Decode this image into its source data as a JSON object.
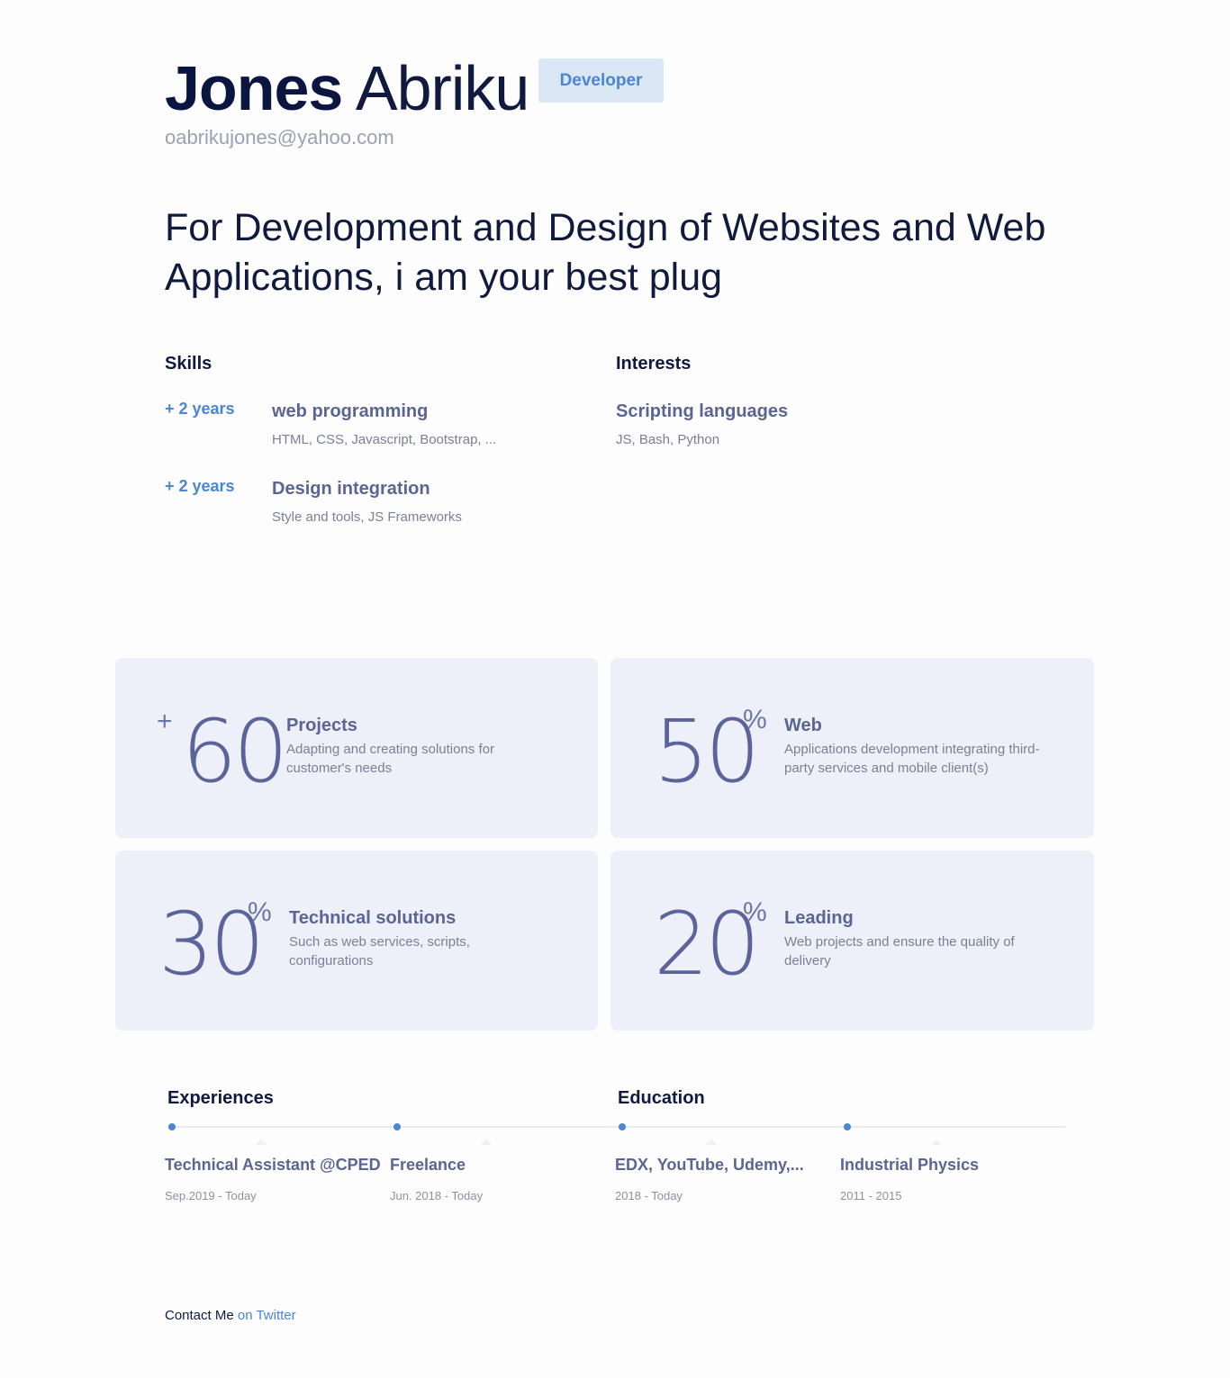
{
  "header": {
    "first_name": "Jones",
    "last_name": "Abriku",
    "role": "Developer",
    "email": "oabrikujones@yahoo.com"
  },
  "tagline": "For Development and Design of Websites and Web Applications, i am your best plug",
  "skills": {
    "title": "Skills",
    "items": [
      {
        "years": "+ 2 years",
        "title": "web programming",
        "sub": "HTML, CSS, Javascript, Bootstrap, ..."
      },
      {
        "years": "+ 2 years",
        "title": "Design integration",
        "sub": "Style and tools, JS Frameworks"
      }
    ]
  },
  "interests": {
    "title": "Interests",
    "items": [
      {
        "title": "Scripting languages",
        "sub": "JS, Bash, Python"
      }
    ]
  },
  "stats": [
    {
      "prefix": "+",
      "number": "60",
      "suffix": "",
      "title": "Projects",
      "desc": "Adapting and creating solutions for customer's needs"
    },
    {
      "prefix": "",
      "number": "50",
      "suffix": "%",
      "title": "Web",
      "desc": "Applications development integrating third-party services and mobile client(s)"
    },
    {
      "prefix": "",
      "number": "30",
      "suffix": "%",
      "title": "Technical solutions",
      "desc": "Such as web services, scripts, configurations"
    },
    {
      "prefix": "",
      "number": "20",
      "suffix": "%",
      "title": "Leading",
      "desc": "Web projects and ensure the quality of delivery"
    }
  ],
  "experiences": {
    "title": "Experiences",
    "items": [
      {
        "title": "Technical Assistant @CPED",
        "date": "Sep.2019 - Today"
      },
      {
        "title": "Freelance",
        "date": "Jun. 2018 - Today"
      }
    ]
  },
  "education": {
    "title": "Education",
    "items": [
      {
        "title": "EDX, YouTube, Udemy,...",
        "date": "2018 - Today"
      },
      {
        "title": "Industrial Physics",
        "date": "2011 - 2015"
      }
    ]
  },
  "contact": {
    "label": "Contact Me",
    "link": "on Twitter"
  },
  "colors": {
    "accent": "#4a86d1",
    "card_bg": "#edf0f8",
    "heading": "#0f1a3d",
    "muted_title": "#5b6593"
  }
}
